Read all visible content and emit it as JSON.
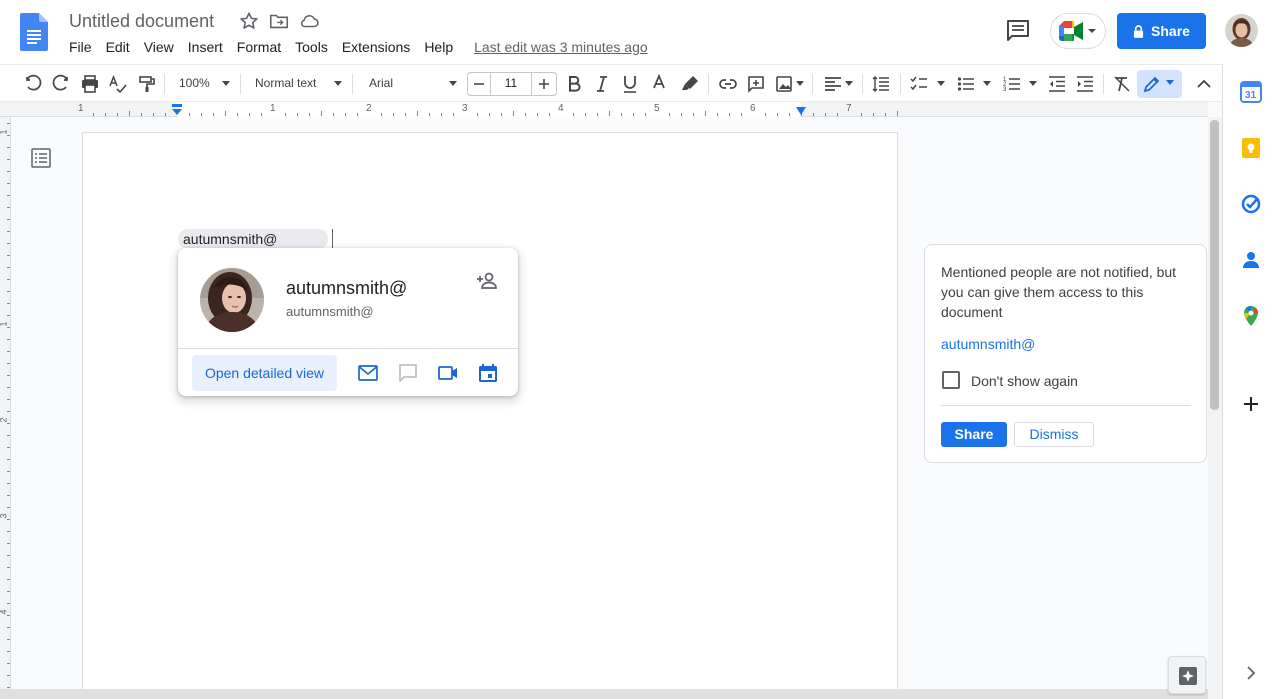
{
  "header": {
    "doc_title": "Untitled document",
    "menu": [
      "File",
      "Edit",
      "View",
      "Insert",
      "Format",
      "Tools",
      "Extensions",
      "Help"
    ],
    "last_edit": "Last edit was 3 minutes ago",
    "share_label": "Share"
  },
  "toolbar": {
    "zoom": "100%",
    "style": "Normal text",
    "font": "Arial",
    "font_size": "11"
  },
  "ruler": {
    "numbers": [
      "1",
      "1",
      "2",
      "3",
      "4",
      "5",
      "6",
      "7"
    ]
  },
  "vruler": {
    "numbers": [
      "1",
      "1",
      "2",
      "3",
      "4"
    ]
  },
  "document": {
    "mention_chip": "autumnsmith@"
  },
  "person_card": {
    "name": "autumnsmith@",
    "email": "autumnsmith@",
    "open_detailed": "Open detailed view"
  },
  "notice": {
    "text": "Mentioned people are not notified, but you can give them access to this document",
    "mention": "autumnsmith@",
    "dont_show": "Don't show again",
    "share": "Share",
    "dismiss": "Dismiss"
  },
  "colors": {
    "accent": "#1a73e8",
    "docs_blue": "#4285f4",
    "chip": "#e8eaed"
  }
}
